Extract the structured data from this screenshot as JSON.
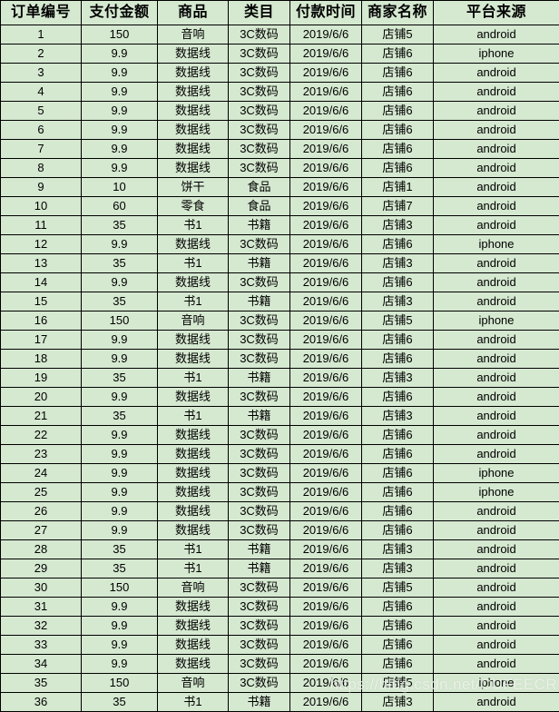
{
  "table": {
    "name": "order-list",
    "accent_color": "#d5e8d0",
    "border_color": "#000000",
    "columns": [
      {
        "key": "order_id",
        "label": "订单编号"
      },
      {
        "key": "amount",
        "label": "支付金额"
      },
      {
        "key": "product",
        "label": "商品"
      },
      {
        "key": "category",
        "label": "类目"
      },
      {
        "key": "pay_time",
        "label": "付款时间"
      },
      {
        "key": "shop",
        "label": "商家名称"
      },
      {
        "key": "platform",
        "label": "平台来源"
      }
    ],
    "rows": [
      [
        "1",
        "150",
        "音响",
        "3C数码",
        "2019/6/6",
        "店铺5",
        "android"
      ],
      [
        "2",
        "9.9",
        "数据线",
        "3C数码",
        "2019/6/6",
        "店铺6",
        "iphone"
      ],
      [
        "3",
        "9.9",
        "数据线",
        "3C数码",
        "2019/6/6",
        "店铺6",
        "android"
      ],
      [
        "4",
        "9.9",
        "数据线",
        "3C数码",
        "2019/6/6",
        "店铺6",
        "android"
      ],
      [
        "5",
        "9.9",
        "数据线",
        "3C数码",
        "2019/6/6",
        "店铺6",
        "android"
      ],
      [
        "6",
        "9.9",
        "数据线",
        "3C数码",
        "2019/6/6",
        "店铺6",
        "android"
      ],
      [
        "7",
        "9.9",
        "数据线",
        "3C数码",
        "2019/6/6",
        "店铺6",
        "android"
      ],
      [
        "8",
        "9.9",
        "数据线",
        "3C数码",
        "2019/6/6",
        "店铺6",
        "android"
      ],
      [
        "9",
        "10",
        "饼干",
        "食品",
        "2019/6/6",
        "店铺1",
        "android"
      ],
      [
        "10",
        "60",
        "零食",
        "食品",
        "2019/6/6",
        "店铺7",
        "android"
      ],
      [
        "11",
        "35",
        "书1",
        "书籍",
        "2019/6/6",
        "店铺3",
        "android"
      ],
      [
        "12",
        "9.9",
        "数据线",
        "3C数码",
        "2019/6/6",
        "店铺6",
        "iphone"
      ],
      [
        "13",
        "35",
        "书1",
        "书籍",
        "2019/6/6",
        "店铺3",
        "android"
      ],
      [
        "14",
        "9.9",
        "数据线",
        "3C数码",
        "2019/6/6",
        "店铺6",
        "android"
      ],
      [
        "15",
        "35",
        "书1",
        "书籍",
        "2019/6/6",
        "店铺3",
        "android"
      ],
      [
        "16",
        "150",
        "音响",
        "3C数码",
        "2019/6/6",
        "店铺5",
        "iphone"
      ],
      [
        "17",
        "9.9",
        "数据线",
        "3C数码",
        "2019/6/6",
        "店铺6",
        "android"
      ],
      [
        "18",
        "9.9",
        "数据线",
        "3C数码",
        "2019/6/6",
        "店铺6",
        "android"
      ],
      [
        "19",
        "35",
        "书1",
        "书籍",
        "2019/6/6",
        "店铺3",
        "android"
      ],
      [
        "20",
        "9.9",
        "数据线",
        "3C数码",
        "2019/6/6",
        "店铺6",
        "android"
      ],
      [
        "21",
        "35",
        "书1",
        "书籍",
        "2019/6/6",
        "店铺3",
        "android"
      ],
      [
        "22",
        "9.9",
        "数据线",
        "3C数码",
        "2019/6/6",
        "店铺6",
        "android"
      ],
      [
        "23",
        "9.9",
        "数据线",
        "3C数码",
        "2019/6/6",
        "店铺6",
        "android"
      ],
      [
        "24",
        "9.9",
        "数据线",
        "3C数码",
        "2019/6/6",
        "店铺6",
        "iphone"
      ],
      [
        "25",
        "9.9",
        "数据线",
        "3C数码",
        "2019/6/6",
        "店铺6",
        "iphone"
      ],
      [
        "26",
        "9.9",
        "数据线",
        "3C数码",
        "2019/6/6",
        "店铺6",
        "android"
      ],
      [
        "27",
        "9.9",
        "数据线",
        "3C数码",
        "2019/6/6",
        "店铺6",
        "android"
      ],
      [
        "28",
        "35",
        "书1",
        "书籍",
        "2019/6/6",
        "店铺3",
        "android"
      ],
      [
        "29",
        "35",
        "书1",
        "书籍",
        "2019/6/6",
        "店铺3",
        "android"
      ],
      [
        "30",
        "150",
        "音响",
        "3C数码",
        "2019/6/6",
        "店铺5",
        "android"
      ],
      [
        "31",
        "9.9",
        "数据线",
        "3C数码",
        "2019/6/6",
        "店铺6",
        "android"
      ],
      [
        "32",
        "9.9",
        "数据线",
        "3C数码",
        "2019/6/6",
        "店铺6",
        "android"
      ],
      [
        "33",
        "9.9",
        "数据线",
        "3C数码",
        "2019/6/6",
        "店铺6",
        "android"
      ],
      [
        "34",
        "9.9",
        "数据线",
        "3C数码",
        "2019/6/6",
        "店铺6",
        "android"
      ],
      [
        "35",
        "150",
        "音响",
        "3C数码",
        "2019/6/6",
        "店铺5",
        "iphone"
      ],
      [
        "36",
        "35",
        "书1",
        "书籍",
        "2019/6/6",
        "店铺3",
        "android"
      ]
    ]
  },
  "watermark": {
    "text": "https://blog.csdn.net/CUFEECR"
  }
}
